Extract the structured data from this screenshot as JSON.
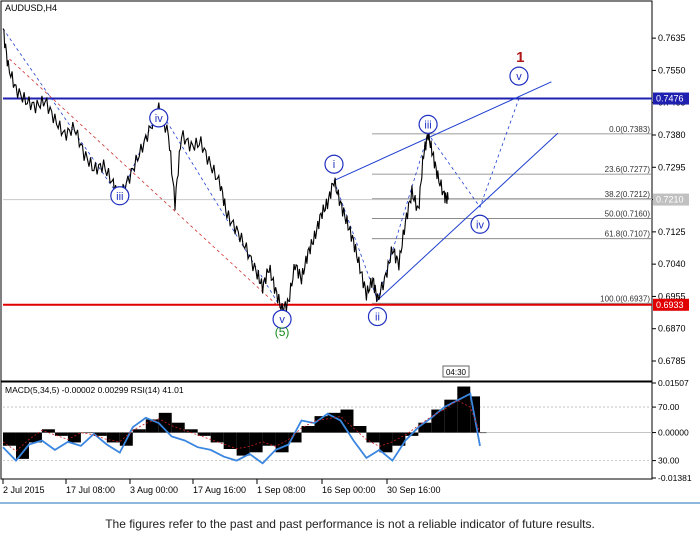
{
  "chart_data": [
    {
      "type": "line",
      "title": "AUDUSD,H4",
      "symbol": "AUDUSD",
      "timeframe": "H4",
      "ylim": [
        0.6735,
        0.7688
      ],
      "price_ticks": [
        "0.7635",
        "0.7550",
        "0.7465",
        "0.7380",
        "0.7295",
        "0.7210",
        "0.7125",
        "0.7040",
        "0.6955",
        "0.6870",
        "0.6785"
      ],
      "x_ticks": [
        "2 Jul 2015",
        "17 Jul 08:00",
        "3 Aug 00:00",
        "17 Aug 16:00",
        "1 Sep 08:00",
        "16 Sep 00:00",
        "30 Sep 16:00"
      ],
      "resistance": {
        "value": 0.7476,
        "label": "0.7476",
        "color": "#1f1fb0"
      },
      "support": {
        "value": 0.6933,
        "label": "0.6933",
        "color": "#e00000"
      },
      "current_price": {
        "value": 0.721,
        "label": "0.7210"
      },
      "time_label": "04:30",
      "fibonacci": [
        {
          "label": "0.0(0.7383)",
          "value": 0.7383
        },
        {
          "label": "23.6(0.7277)",
          "value": 0.7277
        },
        {
          "label": "38.2(0.7212)",
          "value": 0.7212
        },
        {
          "label": "50.0(0.7160)",
          "value": 0.716
        },
        {
          "label": "61.8(0.7107)",
          "value": 0.7107
        },
        {
          "label": "100.0(0.6937)",
          "value": 0.6937
        }
      ],
      "wave_labels": [
        {
          "text": "iii",
          "t": 0.18,
          "price": 0.722,
          "style": "circle"
        },
        {
          "text": "iv",
          "t": 0.24,
          "price": 0.7425,
          "style": "circle"
        },
        {
          "text": "v",
          "t": 0.43,
          "price": 0.6895,
          "style": "circle"
        },
        {
          "text": "5",
          "t": 0.43,
          "price": 0.6862,
          "style": "paren-green"
        },
        {
          "text": "i",
          "t": 0.51,
          "price": 0.7303,
          "style": "circle"
        },
        {
          "text": "ii",
          "t": 0.577,
          "price": 0.6902,
          "style": "circle"
        },
        {
          "text": "iii",
          "t": 0.655,
          "price": 0.7408,
          "style": "circle"
        },
        {
          "text": "iv",
          "t": 0.735,
          "price": 0.7145,
          "style": "circle"
        },
        {
          "text": "v",
          "t": 0.795,
          "price": 0.7535,
          "style": "circle"
        },
        {
          "text": "1",
          "t": 0.797,
          "price": 0.7585,
          "style": "plain-red"
        }
      ],
      "price_path": [
        [
          0.0,
          0.766
        ],
        [
          0.008,
          0.756
        ],
        [
          0.02,
          0.75
        ],
        [
          0.035,
          0.747
        ],
        [
          0.05,
          0.7455
        ],
        [
          0.065,
          0.747
        ],
        [
          0.08,
          0.742
        ],
        [
          0.095,
          0.738
        ],
        [
          0.11,
          0.74
        ],
        [
          0.125,
          0.733
        ],
        [
          0.14,
          0.729
        ],
        [
          0.155,
          0.73
        ],
        [
          0.17,
          0.725
        ],
        [
          0.18,
          0.7215
        ],
        [
          0.195,
          0.727
        ],
        [
          0.21,
          0.733
        ],
        [
          0.225,
          0.739
        ],
        [
          0.24,
          0.745
        ],
        [
          0.255,
          0.738
        ],
        [
          0.265,
          0.72
        ],
        [
          0.275,
          0.738
        ],
        [
          0.29,
          0.735
        ],
        [
          0.305,
          0.736
        ],
        [
          0.32,
          0.73
        ],
        [
          0.335,
          0.725
        ],
        [
          0.345,
          0.717
        ],
        [
          0.36,
          0.713
        ],
        [
          0.375,
          0.708
        ],
        [
          0.39,
          0.702
        ],
        [
          0.4,
          0.698
        ],
        [
          0.41,
          0.703
        ],
        [
          0.42,
          0.697
        ],
        [
          0.43,
          0.692
        ],
        [
          0.44,
          0.694
        ],
        [
          0.45,
          0.704
        ],
        [
          0.46,
          0.7
        ],
        [
          0.47,
          0.707
        ],
        [
          0.48,
          0.711
        ],
        [
          0.49,
          0.717
        ],
        [
          0.5,
          0.72
        ],
        [
          0.51,
          0.726
        ],
        [
          0.52,
          0.72
        ],
        [
          0.53,
          0.715
        ],
        [
          0.54,
          0.71
        ],
        [
          0.55,
          0.703
        ],
        [
          0.56,
          0.696
        ],
        [
          0.57,
          0.7
        ],
        [
          0.577,
          0.6945
        ],
        [
          0.59,
          0.701
        ],
        [
          0.6,
          0.708
        ],
        [
          0.61,
          0.704
        ],
        [
          0.62,
          0.715
        ],
        [
          0.63,
          0.723
        ],
        [
          0.64,
          0.718
        ],
        [
          0.648,
          0.733
        ],
        [
          0.655,
          0.7383
        ],
        [
          0.662,
          0.733
        ],
        [
          0.67,
          0.727
        ],
        [
          0.68,
          0.722
        ],
        [
          0.686,
          0.721
        ]
      ]
    },
    {
      "type": "line",
      "title": "MACD(5,34,5) -0.00002 0.00299 RSI(14) 41.01",
      "macd_ticks": [
        "0.01507",
        "0.00000",
        "-0.01381"
      ],
      "rsi_ticks": [
        "70.00",
        "30.00"
      ],
      "macd_ylim": [
        -0.01381,
        0.01507
      ],
      "rsi_ylim": [
        17,
        88
      ],
      "macd_histogram": [
        [
          0.0,
          -0.004
        ],
        [
          0.02,
          -0.008
        ],
        [
          0.04,
          -0.003
        ],
        [
          0.06,
          0.001
        ],
        [
          0.08,
          -0.001
        ],
        [
          0.1,
          -0.003
        ],
        [
          0.12,
          0.0
        ],
        [
          0.14,
          -0.001
        ],
        [
          0.16,
          -0.003
        ],
        [
          0.18,
          -0.004
        ],
        [
          0.2,
          0.001
        ],
        [
          0.22,
          0.004
        ],
        [
          0.24,
          0.006
        ],
        [
          0.26,
          0.003
        ],
        [
          0.28,
          0.001
        ],
        [
          0.3,
          -0.001
        ],
        [
          0.32,
          -0.003
        ],
        [
          0.34,
          -0.005
        ],
        [
          0.36,
          -0.007
        ],
        [
          0.38,
          -0.006
        ],
        [
          0.4,
          -0.004
        ],
        [
          0.42,
          -0.006
        ],
        [
          0.44,
          -0.003
        ],
        [
          0.46,
          0.002
        ],
        [
          0.48,
          0.005
        ],
        [
          0.5,
          0.006
        ],
        [
          0.52,
          0.007
        ],
        [
          0.54,
          0.002
        ],
        [
          0.56,
          -0.003
        ],
        [
          0.58,
          -0.006
        ],
        [
          0.6,
          -0.004
        ],
        [
          0.62,
          -0.001
        ],
        [
          0.64,
          0.003
        ],
        [
          0.66,
          0.007
        ],
        [
          0.68,
          0.01
        ],
        [
          0.7,
          0.014
        ],
        [
          0.72,
          0.011
        ],
        [
          0.735,
          0.0
        ]
      ],
      "rsi_path": [
        [
          0.0,
          40
        ],
        [
          0.02,
          30
        ],
        [
          0.04,
          42
        ],
        [
          0.06,
          45
        ],
        [
          0.08,
          38
        ],
        [
          0.1,
          44
        ],
        [
          0.12,
          41
        ],
        [
          0.14,
          50
        ],
        [
          0.16,
          42
        ],
        [
          0.18,
          36
        ],
        [
          0.2,
          55
        ],
        [
          0.22,
          62
        ],
        [
          0.24,
          58
        ],
        [
          0.26,
          48
        ],
        [
          0.28,
          45
        ],
        [
          0.3,
          40
        ],
        [
          0.32,
          38
        ],
        [
          0.34,
          33
        ],
        [
          0.36,
          30
        ],
        [
          0.38,
          35
        ],
        [
          0.4,
          28
        ],
        [
          0.42,
          38
        ],
        [
          0.44,
          42
        ],
        [
          0.46,
          60
        ],
        [
          0.48,
          58
        ],
        [
          0.5,
          65
        ],
        [
          0.52,
          60
        ],
        [
          0.54,
          45
        ],
        [
          0.56,
          32
        ],
        [
          0.58,
          38
        ],
        [
          0.6,
          30
        ],
        [
          0.62,
          45
        ],
        [
          0.64,
          55
        ],
        [
          0.66,
          62
        ],
        [
          0.68,
          70
        ],
        [
          0.7,
          75
        ],
        [
          0.72,
          80
        ],
        [
          0.735,
          41
        ]
      ]
    }
  ],
  "disclaimer": "The figures refer to the past and past performance is not a reliable indicator of future results."
}
